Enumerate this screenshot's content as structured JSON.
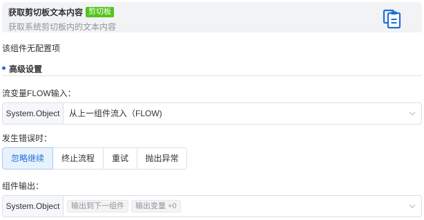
{
  "header": {
    "title": "获取剪切板文本内容",
    "tag": "剪切板",
    "description": "获取系统剪切板内的文本内容",
    "icon": "clipboard-icon",
    "accent": "#1e6fd9",
    "tag_color": "#52c41a"
  },
  "no_config_text": "该组件无配置项",
  "advanced": {
    "title": "高级设置"
  },
  "flow_input": {
    "label": "流变量FLOW输入：",
    "type": "System.Object",
    "value": "从上一组件流入（FLOW)"
  },
  "on_error": {
    "label": "发生错误时：",
    "options": [
      "忽略继续",
      "终止流程",
      "重试",
      "抛出异常"
    ],
    "selected": "忽略继续"
  },
  "output": {
    "label": "组件输出：",
    "type": "System.Object",
    "chips": [
      "输出到下一组件",
      "输出变量 +0"
    ]
  }
}
